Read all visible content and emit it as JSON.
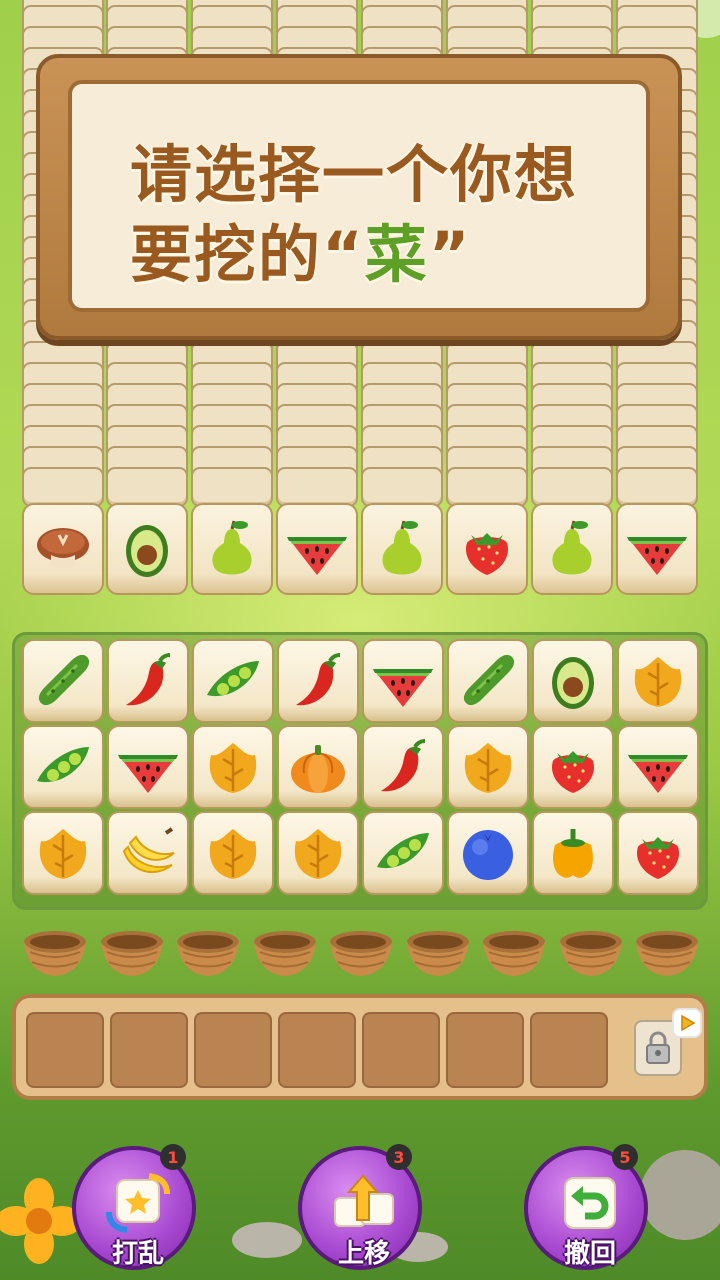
{
  "prompt": {
    "line1": "请选择一个你想",
    "line2_prefix": "要挖的",
    "open_quote": "“",
    "highlight": "菜",
    "close_quote": "”"
  },
  "top_tiles": [
    "mushroom",
    "avocado",
    "pear",
    "watermelon",
    "pear",
    "strawberry",
    "pear",
    "watermelon"
  ],
  "board": {
    "rows": [
      [
        "cucumber",
        "chili",
        "peapod",
        "chili",
        "watermelon",
        "cucumber",
        "avocado",
        "leaf"
      ],
      [
        "peapod",
        "watermelon",
        "leaf",
        "pumpkin",
        "chili",
        "leaf",
        "strawberry",
        "watermelon"
      ],
      [
        "leaf",
        "banana",
        "leaf",
        "leaf",
        "peapod",
        "blueberry",
        "bellpepper",
        "strawberry"
      ]
    ]
  },
  "basket_count": 9,
  "tray_slots": 7,
  "tools": [
    {
      "label": "打乱",
      "count": "1",
      "icon": "shuffle-dice-icon"
    },
    {
      "label": "上移",
      "count": "3",
      "icon": "move-up-icon"
    },
    {
      "label": "撤回",
      "count": "5",
      "icon": "undo-icon"
    }
  ],
  "colors": {
    "prompt_text": "#9a5a1f",
    "prompt_highlight": "#5ea025",
    "tool_purple": "#a748d0",
    "badge_red": "#ff4d3d"
  }
}
